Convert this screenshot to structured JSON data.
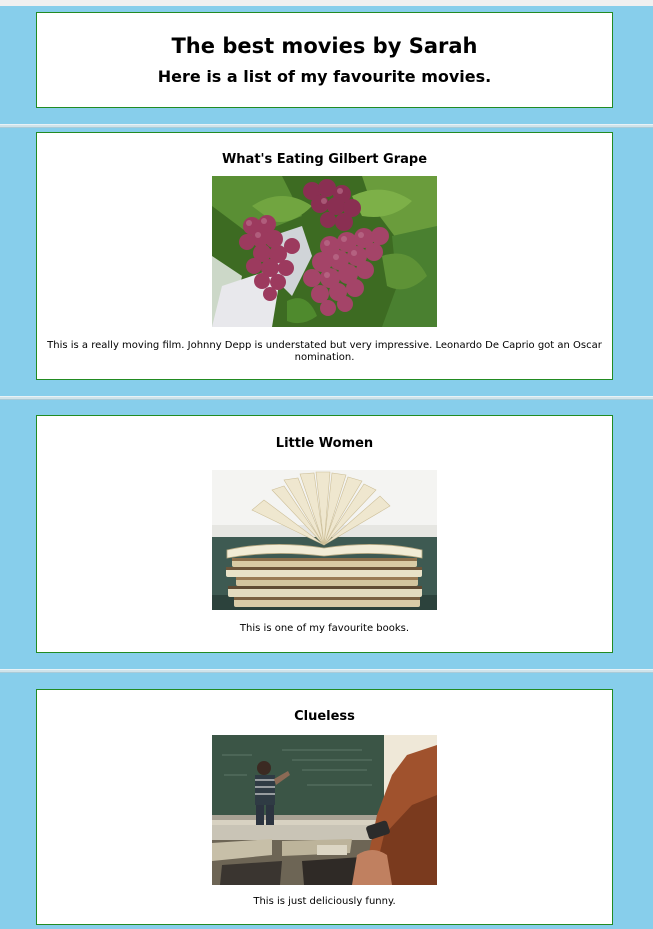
{
  "header": {
    "title": "The best movies by Sarah",
    "subtitle": "Here is a list of my favourite movies."
  },
  "movies": [
    {
      "title": "What's Eating Gilbert Grape",
      "image": "grapes-photo",
      "description": "This is a really moving film. Johnny Depp is understated but very impressive. Leonardo De Caprio got an Oscar nomination."
    },
    {
      "title": "Little Women",
      "image": "books-photo",
      "description": "This is one of my favourite books."
    },
    {
      "title": "Clueless",
      "image": "classroom-photo",
      "description": "This is just deliciously funny."
    }
  ],
  "colors": {
    "page_background": "#87ceeb",
    "box_border": "#228b22",
    "box_background": "#ffffff"
  }
}
